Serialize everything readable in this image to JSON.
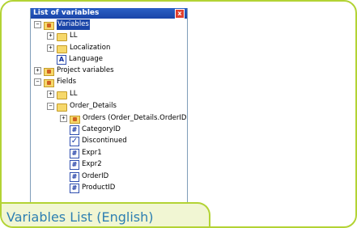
{
  "window": {
    "title": "List of variables",
    "close_label": "x"
  },
  "tree": [
    {
      "label": "Variables",
      "icon": "folder-database-icon",
      "expander": "−",
      "selected": true
    },
    {
      "label": "LL",
      "icon": "folder-icon",
      "expander": "+"
    },
    {
      "label": "Localization",
      "icon": "folder-icon",
      "expander": "+"
    },
    {
      "label": "Language",
      "icon": "text-variable-icon",
      "glyph": "A"
    },
    {
      "label": "Project variables",
      "icon": "folder-database-icon",
      "expander": "+"
    },
    {
      "label": "Fields",
      "icon": "folder-database-icon",
      "expander": "−"
    },
    {
      "label": "LL",
      "icon": "folder-icon",
      "expander": "+"
    },
    {
      "label": "Order_Details",
      "icon": "folder-icon",
      "expander": "−"
    },
    {
      "label": "Orders (Order_Details.OrderID",
      "icon": "folder-database-icon",
      "expander": "+"
    },
    {
      "label": "CategoryID",
      "icon": "numeric-field-icon",
      "glyph": "#"
    },
    {
      "label": "Discontinued",
      "icon": "boolean-field-icon",
      "glyph": "✓"
    },
    {
      "label": "Expr1",
      "icon": "numeric-field-icon",
      "glyph": "#"
    },
    {
      "label": "Expr2",
      "icon": "numeric-field-icon",
      "glyph": "#"
    },
    {
      "label": "OrderID",
      "icon": "numeric-field-icon",
      "glyph": "#"
    },
    {
      "label": "ProductID",
      "icon": "numeric-field-icon",
      "glyph": "#"
    }
  ],
  "caption": "Variables List (English)",
  "colors": {
    "accent": "#b3d334",
    "caption_bg": "#f1f6d3",
    "caption_text": "#2d7fb2",
    "titlebar": "#1a45a8"
  }
}
